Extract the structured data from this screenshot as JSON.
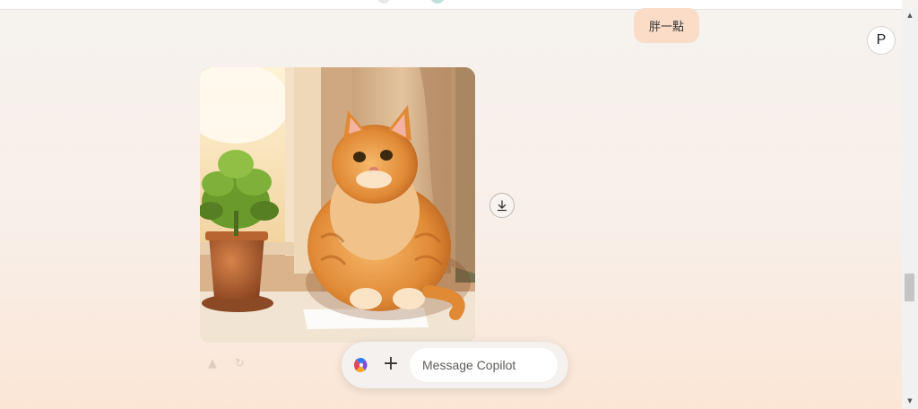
{
  "user_message": {
    "text": "胖一點"
  },
  "avatar": {
    "initial": "P"
  },
  "image": {
    "alt": "Orange fat cat sitting by a sunny window next to a potted succulent"
  },
  "composer": {
    "placeholder": "Message Copilot",
    "add_label": "+"
  },
  "icons": {
    "copilot_logo": "copilot-logo-icon",
    "download": "download-icon",
    "plus": "plus-icon",
    "scroll_up": "scroll-up-arrow-icon",
    "scroll_down": "scroll-down-arrow-icon"
  },
  "colors": {
    "user_bubble": "#fadcc7",
    "background_top": "#f6f2ef",
    "background_bottom": "#fbe6d6"
  }
}
